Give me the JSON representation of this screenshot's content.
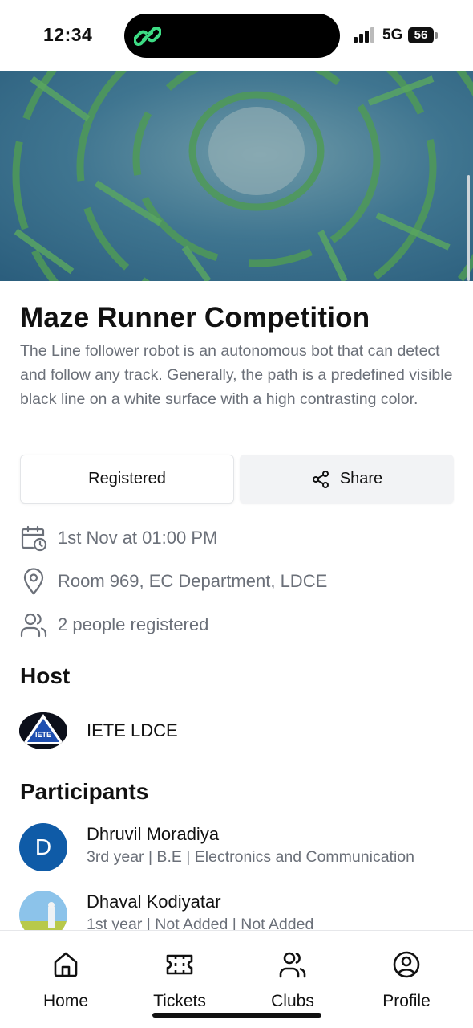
{
  "status_bar": {
    "time": "12:34",
    "network": "5G",
    "battery": "56",
    "app_indicator_icon": "link-icon",
    "app_indicator_color": "#3ddc84"
  },
  "event": {
    "title": "Maze Runner Competition",
    "description": "The Line follower robot is an autonomous bot that can detect and follow any track. Generally, the path is a predefined visible black line on a white surface with a high contrasting color.",
    "hero_image": "aerial hedge maze"
  },
  "actions": {
    "registered_label": "Registered",
    "share_label": "Share"
  },
  "details": {
    "datetime": "1st Nov at 01:00 PM",
    "location": "Room 969, EC Department, LDCE",
    "registered_count": "2 people registered"
  },
  "host": {
    "heading": "Host",
    "name": "IETE LDCE",
    "logo_text": "IETE"
  },
  "participants": {
    "heading": "Participants",
    "items": [
      {
        "name": "Dhruvil Moradiya",
        "details": "3rd year | B.E | Electronics and Communication",
        "initial": "D"
      },
      {
        "name": "Dhaval Kodiyatar",
        "details": "1st year | Not Added | Not Added"
      }
    ]
  },
  "nav": {
    "items": [
      {
        "label": "Home",
        "icon": "home-icon"
      },
      {
        "label": "Tickets",
        "icon": "ticket-icon"
      },
      {
        "label": "Clubs",
        "icon": "users-icon"
      },
      {
        "label": "Profile",
        "icon": "user-circle-icon"
      }
    ]
  },
  "colors": {
    "muted_text": "#6b7079",
    "avatar_blue": "#0f5ba7",
    "share_bg": "#f2f3f5"
  }
}
